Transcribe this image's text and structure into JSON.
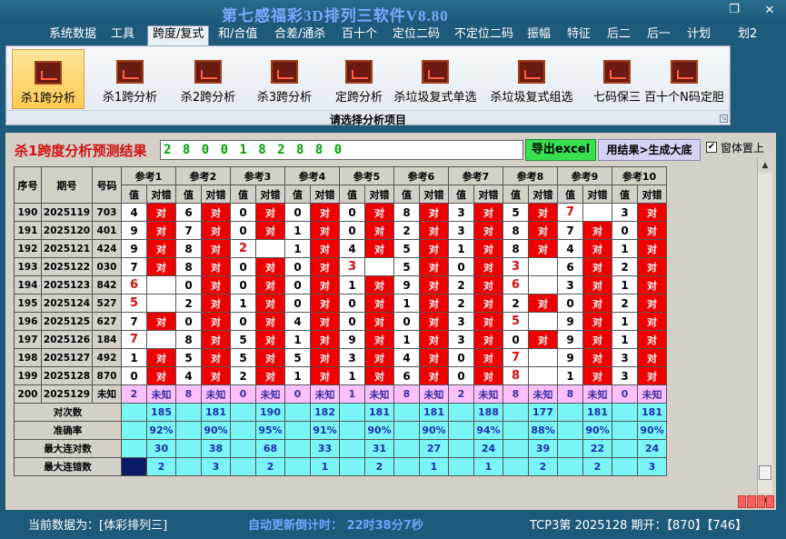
{
  "app_title": "第七感福彩3D排列三软件V8.80",
  "window_buttons": {
    "minimize": "-",
    "restore": "❐",
    "close": "✕"
  },
  "menu": [
    {
      "label": "系统数据",
      "active": false
    },
    {
      "label": "工具",
      "active": false
    },
    {
      "label": "跨度/复式",
      "active": true
    },
    {
      "label": "和/合值",
      "active": false
    },
    {
      "label": "合差/通杀",
      "active": false
    },
    {
      "label": "百十个",
      "active": false
    },
    {
      "label": "定位二码",
      "active": false
    },
    {
      "label": "不定位二码",
      "active": false
    },
    {
      "label": "振幅",
      "active": false
    },
    {
      "label": "特征",
      "active": false
    },
    {
      "label": "后二",
      "active": false
    },
    {
      "label": "后一",
      "active": false
    },
    {
      "label": "计划",
      "active": false
    },
    {
      "label": "划2",
      "active": false
    }
  ],
  "ribbon": {
    "buttons": [
      {
        "label": "杀1跨分析",
        "active": true
      },
      {
        "label": "杀1跨分析",
        "active": false
      },
      {
        "label": "杀2跨分析",
        "active": false
      },
      {
        "label": "杀3跨分析",
        "active": false
      },
      {
        "label": "定跨分析",
        "active": false
      },
      {
        "label": "杀垃圾复式单选",
        "active": false
      },
      {
        "label": "杀垃圾复式组选",
        "active": false
      },
      {
        "label": "七码保三",
        "active": false
      },
      {
        "label": "百十个N码定胆",
        "active": false
      }
    ],
    "caption": "请选择分析项目",
    "icon": "chart-icon"
  },
  "result": {
    "label": "杀1跨度分析预测结果",
    "value": "2 8 0 0 1 8 2 8 8 0",
    "export_label": "导出excel",
    "generate_label": "用结果>生成大底",
    "topmost_label": "窗体置上",
    "topmost_checked": "✔"
  },
  "grid": {
    "headers": {
      "seq": "序号",
      "period": "期号",
      "number": "号码",
      "refs": [
        "参考1",
        "参考2",
        "参考3",
        "参考4",
        "参考5",
        "参考6",
        "参考7",
        "参考8",
        "参考9",
        "参考10"
      ],
      "value": "值",
      "check": "对错"
    },
    "hit_text": "对",
    "unknown_text": "未知",
    "rows": [
      {
        "seq": "190",
        "period": "2025119",
        "number": "703",
        "vals": [
          "4",
          "6",
          "0",
          "0",
          "0",
          "8",
          "3",
          "5",
          "7",
          "3"
        ],
        "hits": [
          1,
          1,
          1,
          1,
          1,
          1,
          1,
          1,
          0,
          1
        ],
        "hl": [
          0,
          0,
          0,
          0,
          0,
          0,
          0,
          0,
          1,
          0
        ]
      },
      {
        "seq": "191",
        "period": "2025120",
        "number": "401",
        "vals": [
          "9",
          "7",
          "0",
          "1",
          "0",
          "2",
          "3",
          "8",
          "7",
          "0"
        ],
        "hits": [
          1,
          1,
          1,
          1,
          1,
          1,
          1,
          1,
          1,
          1
        ],
        "hl": [
          0,
          0,
          0,
          0,
          0,
          0,
          0,
          0,
          0,
          0
        ]
      },
      {
        "seq": "192",
        "period": "2025121",
        "number": "424",
        "vals": [
          "9",
          "8",
          "2",
          "1",
          "4",
          "5",
          "1",
          "8",
          "4",
          "1"
        ],
        "hits": [
          1,
          1,
          0,
          1,
          1,
          1,
          1,
          1,
          1,
          1
        ],
        "hl": [
          0,
          0,
          1,
          0,
          0,
          0,
          0,
          0,
          0,
          0
        ]
      },
      {
        "seq": "193",
        "period": "2025122",
        "number": "030",
        "vals": [
          "7",
          "8",
          "0",
          "0",
          "3",
          "5",
          "0",
          "3",
          "6",
          "2"
        ],
        "hits": [
          1,
          1,
          1,
          1,
          0,
          1,
          1,
          0,
          1,
          1
        ],
        "hl": [
          0,
          0,
          0,
          0,
          1,
          0,
          0,
          1,
          0,
          0
        ]
      },
      {
        "seq": "194",
        "period": "2025123",
        "number": "842",
        "vals": [
          "6",
          "0",
          "0",
          "0",
          "1",
          "9",
          "2",
          "6",
          "3",
          "1"
        ],
        "hits": [
          0,
          1,
          1,
          1,
          1,
          1,
          1,
          0,
          1,
          1
        ],
        "hl": [
          1,
          0,
          0,
          0,
          0,
          0,
          0,
          1,
          0,
          0
        ]
      },
      {
        "seq": "195",
        "period": "2025124",
        "number": "527",
        "vals": [
          "5",
          "2",
          "1",
          "0",
          "0",
          "1",
          "2",
          "2",
          "0",
          "2"
        ],
        "hits": [
          0,
          1,
          1,
          1,
          1,
          1,
          1,
          1,
          1,
          1
        ],
        "hl": [
          1,
          0,
          0,
          0,
          0,
          0,
          0,
          0,
          0,
          0
        ]
      },
      {
        "seq": "196",
        "period": "2025125",
        "number": "627",
        "vals": [
          "7",
          "0",
          "0",
          "4",
          "0",
          "0",
          "3",
          "5",
          "9",
          "1"
        ],
        "hits": [
          1,
          1,
          1,
          1,
          1,
          1,
          1,
          0,
          1,
          1
        ],
        "hl": [
          0,
          0,
          0,
          0,
          0,
          0,
          0,
          1,
          0,
          0
        ]
      },
      {
        "seq": "197",
        "period": "2025126",
        "number": "184",
        "vals": [
          "7",
          "8",
          "5",
          "1",
          "9",
          "1",
          "3",
          "0",
          "9",
          "1"
        ],
        "hits": [
          0,
          1,
          1,
          1,
          1,
          1,
          1,
          1,
          1,
          1
        ],
        "hl": [
          1,
          0,
          0,
          0,
          0,
          0,
          0,
          0,
          0,
          0
        ]
      },
      {
        "seq": "198",
        "period": "2025127",
        "number": "492",
        "vals": [
          "1",
          "5",
          "5",
          "5",
          "3",
          "4",
          "0",
          "7",
          "9",
          "3"
        ],
        "hits": [
          1,
          1,
          1,
          1,
          1,
          1,
          1,
          0,
          1,
          1
        ],
        "hl": [
          0,
          0,
          0,
          0,
          0,
          0,
          0,
          1,
          0,
          0
        ]
      },
      {
        "seq": "199",
        "period": "2025128",
        "number": "870",
        "vals": [
          "0",
          "4",
          "2",
          "1",
          "1",
          "6",
          "0",
          "8",
          "1",
          "3"
        ],
        "hits": [
          1,
          1,
          1,
          1,
          1,
          1,
          1,
          0,
          1,
          1
        ],
        "hl": [
          0,
          0,
          0,
          0,
          0,
          0,
          0,
          1,
          0,
          0
        ]
      }
    ],
    "unknown_row": {
      "seq": "200",
      "period": "2025129",
      "number": "未知",
      "vals": [
        "2",
        "8",
        "0",
        "0",
        "1",
        "8",
        "2",
        "8",
        "8",
        "0"
      ]
    },
    "stats": [
      {
        "label": "对次数",
        "vals": [
          "185",
          "181",
          "190",
          "182",
          "181",
          "181",
          "188",
          "177",
          "181",
          "181"
        ]
      },
      {
        "label": "准确率",
        "vals": [
          "92%",
          "90%",
          "95%",
          "91%",
          "90%",
          "90%",
          "94%",
          "88%",
          "90%",
          "90%"
        ]
      },
      {
        "label": "最大连对数",
        "vals": [
          "30",
          "38",
          "68",
          "33",
          "31",
          "27",
          "24",
          "39",
          "22",
          "24"
        ]
      },
      {
        "label": "最大连错数",
        "vals": [
          "2",
          "3",
          "2",
          "1",
          "2",
          "1",
          "1",
          "2",
          "2",
          "3"
        ]
      }
    ]
  },
  "status": {
    "left": "当前数据为：[体彩排列三]",
    "countdown": "自动更新倒计时：  22时38分7秒",
    "right": "TCP3第 2025128 期开：【870】【746】"
  },
  "colors": {
    "hit": "#ee0000",
    "unknown_row": "#ffc0ff",
    "stats_row": "#7af6f6",
    "title": "#7aa8ff"
  }
}
